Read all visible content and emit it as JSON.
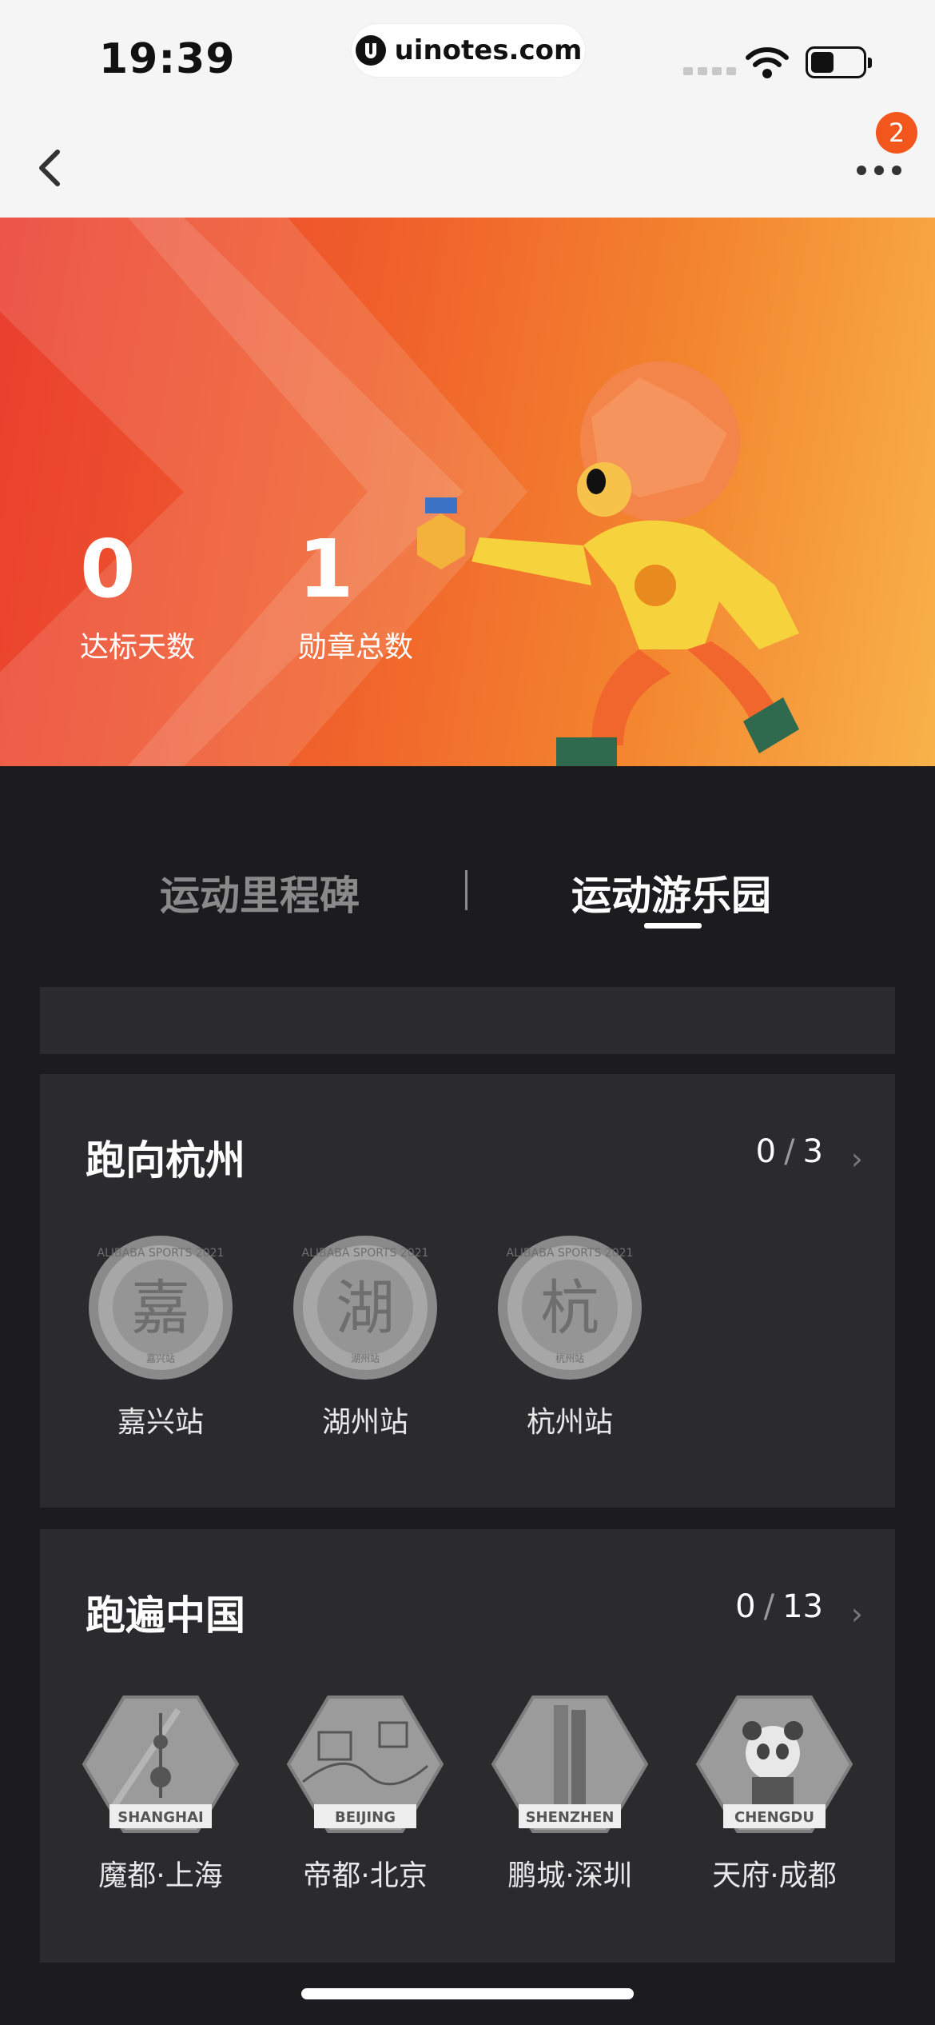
{
  "status_bar": {
    "time": "19:39",
    "url": "uinotes.com"
  },
  "nav": {
    "badge_count": "2"
  },
  "hero": {
    "stats": [
      {
        "value": "0",
        "label": "达标天数"
      },
      {
        "value": "1",
        "label": "勋章总数"
      }
    ]
  },
  "tabs": [
    {
      "label": "运动里程碑",
      "active": false
    },
    {
      "label": "运动游乐园",
      "active": true
    }
  ],
  "sections": [
    {
      "title": "跑向杭州",
      "progress": {
        "done": "0",
        "sep": "/",
        "total": "3"
      },
      "medals": [
        {
          "label": "嘉兴站",
          "glyph": "嘉",
          "sub": "嘉兴站"
        },
        {
          "label": "湖州站",
          "glyph": "湖",
          "sub": "湖州站"
        },
        {
          "label": "杭州站",
          "glyph": "杭",
          "sub": "杭州站"
        }
      ],
      "ring_text": "ALIBABA SPORTS 2021"
    },
    {
      "title": "跑遍中国",
      "progress": {
        "done": "0",
        "sep": "/",
        "total": "13"
      },
      "medals": [
        {
          "label": "魔都·上海",
          "banner": "SHANGHAI"
        },
        {
          "label": "帝都·北京",
          "banner": "BEIJING"
        },
        {
          "label": "鹏城·深圳",
          "banner": "SHENZHEN"
        },
        {
          "label": "天府·成都",
          "banner": "CHENGDU"
        }
      ]
    }
  ],
  "colors": {
    "accent": "#f2561d",
    "card_bg": "#2b2b2e",
    "page_bg": "#1c1c1e"
  }
}
